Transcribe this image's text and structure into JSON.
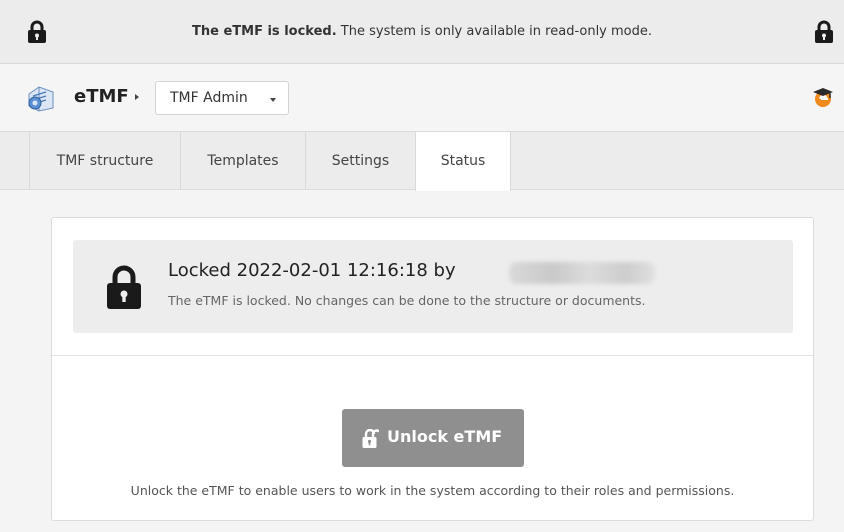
{
  "banner": {
    "message_bold": "The eTMF is locked.",
    "message_rest": " The system is only available in read-only mode."
  },
  "appbar": {
    "app_name": "eTMF",
    "dropdown_selected": "TMF Admin",
    "icons": [
      "etmf-app-icon",
      "help-cap-icon"
    ]
  },
  "tabs": [
    {
      "label": "TMF structure",
      "active": false
    },
    {
      "label": "Templates",
      "active": false
    },
    {
      "label": "Settings",
      "active": false
    },
    {
      "label": "Status",
      "active": true
    }
  ],
  "status": {
    "title": "Locked 2022-02-01 12:16:18 by",
    "subtitle": "The eTMF is locked. No changes can be done to the structure or documents."
  },
  "unlock": {
    "button_label": "Unlock eTMF",
    "help_text": "Unlock the eTMF to enable users to work in the system according to their roles and permissions."
  },
  "colors": {
    "banner_bg": "#ececec",
    "button_bg": "#8f8f8f",
    "help_icon_orange": "#f08a1c"
  }
}
